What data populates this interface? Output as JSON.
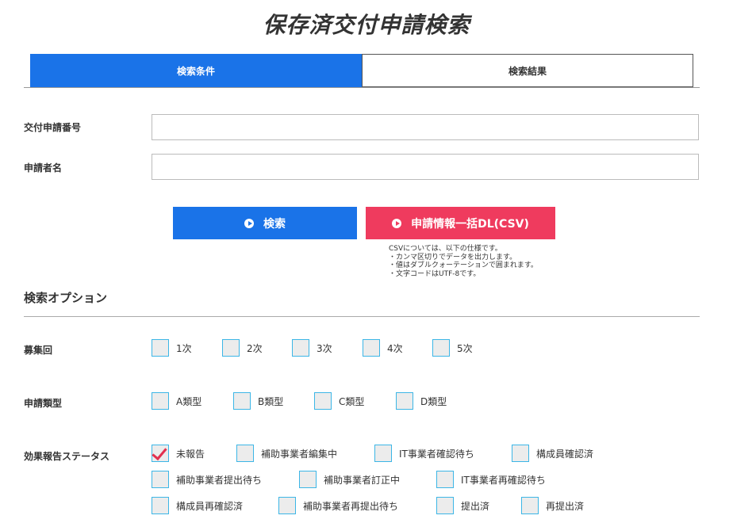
{
  "page": {
    "title": "保存済交付申請検索"
  },
  "tabs": [
    {
      "label": "検索条件",
      "active": true
    },
    {
      "label": "検索結果",
      "active": false
    }
  ],
  "fields": {
    "application_number": {
      "label": "交付申請番号",
      "value": "",
      "placeholder": ""
    },
    "applicant_name": {
      "label": "申請者名",
      "value": "",
      "placeholder": ""
    }
  },
  "buttons": {
    "search": "検索",
    "csv_download": "申請情報一括DL(CSV)"
  },
  "csv_note": {
    "lines": [
      "CSVについては、以下の仕様です。",
      "・カンマ区切りでデータを出力します。",
      "・値はダブルクォーテーションで囲まれます。",
      "・文字コードはUTF-8です。"
    ]
  },
  "options": {
    "title": "検索オプション",
    "recruitment": {
      "label": "募集回",
      "items": [
        {
          "label": "1次",
          "checked": false
        },
        {
          "label": "2次",
          "checked": false
        },
        {
          "label": "3次",
          "checked": false
        },
        {
          "label": "4次",
          "checked": false
        },
        {
          "label": "5次",
          "checked": false
        }
      ]
    },
    "application_type": {
      "label": "申請類型",
      "items": [
        {
          "label": "A類型",
          "checked": false
        },
        {
          "label": "B類型",
          "checked": false
        },
        {
          "label": "C類型",
          "checked": false
        },
        {
          "label": "D類型",
          "checked": false
        }
      ]
    },
    "report_status": {
      "label": "効果報告ステータス",
      "items": [
        {
          "label": "未報告",
          "checked": true
        },
        {
          "label": "補助事業者編集中",
          "checked": false
        },
        {
          "label": "IT事業者確認待ち",
          "checked": false
        },
        {
          "label": "構成員確認済",
          "checked": false
        },
        {
          "label": "補助事業者提出待ち",
          "checked": false
        },
        {
          "label": "補助事業者訂正中",
          "checked": false
        },
        {
          "label": "IT事業者再確認待ち",
          "checked": false
        },
        {
          "label": "構成員再確認済",
          "checked": false
        },
        {
          "label": "補助事業者再提出待ち",
          "checked": false
        },
        {
          "label": "提出済",
          "checked": false
        },
        {
          "label": "再提出済",
          "checked": false
        }
      ]
    }
  },
  "colors": {
    "primary": "#1a73e8",
    "csv_button": "#ef3b5e",
    "checkbox_border": "#3cb6e6",
    "check_mark": "#e2304f"
  }
}
